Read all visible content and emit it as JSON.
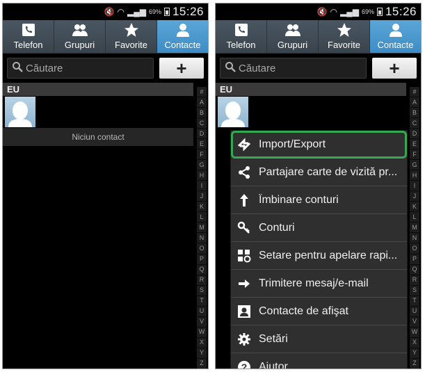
{
  "status": {
    "battery": "69%",
    "time": "15:26"
  },
  "tabs": [
    {
      "label": "Telefon",
      "icon": "phone-icon"
    },
    {
      "label": "Grupuri",
      "icon": "group-icon"
    },
    {
      "label": "Favorite",
      "icon": "star-icon"
    },
    {
      "label": "Contacte",
      "icon": "person-icon"
    }
  ],
  "search": {
    "placeholder": "Căutare"
  },
  "add_label": "+",
  "section": {
    "header": "EU"
  },
  "no_contact": "Niciun contact",
  "index_letters": [
    "#",
    "A",
    "B",
    "C",
    "D",
    "E",
    "F",
    "G",
    "H",
    "I",
    "J",
    "K",
    "L",
    "M",
    "N",
    "O",
    "P",
    "Q",
    "R",
    "S",
    "T",
    "U",
    "V",
    "W",
    "X",
    "Y",
    "Z"
  ],
  "menu": {
    "items": [
      {
        "label": "Import/Export",
        "icon": "import-export-icon"
      },
      {
        "label": "Partajare carte de vizită pr...",
        "icon": "share-icon"
      },
      {
        "label": "Îmbinare conturi",
        "icon": "merge-icon"
      },
      {
        "label": "Conturi",
        "icon": "key-icon"
      },
      {
        "label": "Setare pentru apelare rapi...",
        "icon": "speed-dial-icon"
      },
      {
        "label": "Trimitere mesaj/e-mail",
        "icon": "arrow-right-icon"
      },
      {
        "label": "Contacte de afişat",
        "icon": "contact-card-icon"
      },
      {
        "label": "Setări",
        "icon": "gear-icon"
      },
      {
        "label": "Ajutor",
        "icon": "help-icon"
      }
    ]
  },
  "colors": {
    "active_tab": "#4a9ad0",
    "highlight_outline": "#34a853"
  }
}
